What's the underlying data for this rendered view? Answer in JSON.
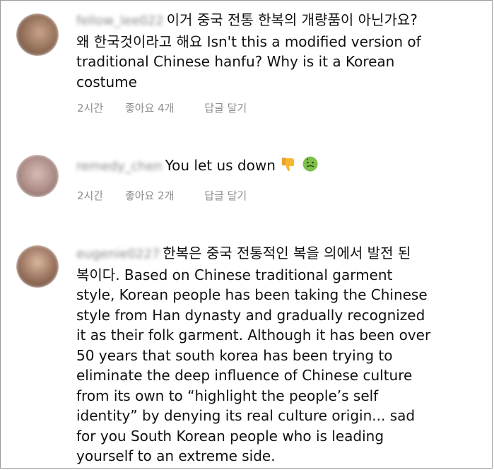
{
  "comments": [
    {
      "username": "fellow_lee022",
      "lines": [
        "이거 중국 전통 한복의 개량품이 아닌가요?",
        "왜 한국것이라고 해요  Isn't this a modified version of",
        "traditional Chinese hanfu? Why is it a Korean",
        "costume"
      ],
      "time": "2시간",
      "likes": "좋아요 4개",
      "reply": "답글 달기",
      "avatar_color": "#8a6a55"
    },
    {
      "username": "remedy_chen",
      "lines": [
        "You let us down"
      ],
      "emojis": [
        "thumbs-down-icon",
        "nauseated-face-icon"
      ],
      "time": "2시간",
      "likes": "좋아요 2개",
      "reply": "답글 달기",
      "avatar_color": "#b89a92"
    },
    {
      "username": "eugenie0227",
      "lines": [
        "한복은 중국 전통적인 복을 의에서 발전 된",
        "복이다. Based on Chinese traditional garment",
        "style, Korean people has been taking the Chinese",
        "style from Han dynasty and gradually recognized",
        "it as their folk garment. Although it has been over",
        "50 years that south korea has been trying to",
        "eliminate the deep influence of Chinese culture",
        "from its own to “highlight the people’s self",
        "identity” by denying its real culture origin... sad",
        "for you South Korean people who is leading",
        "yourself to an extreme side."
      ],
      "avatar_color": "#8c6a5a"
    }
  ]
}
